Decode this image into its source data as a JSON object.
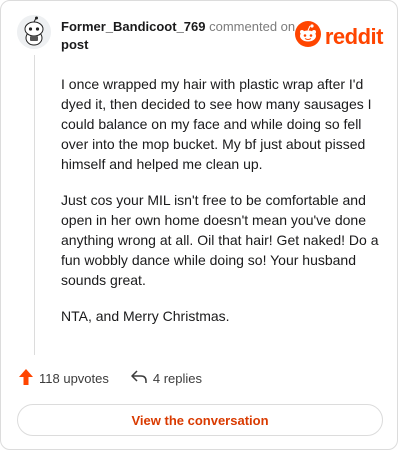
{
  "comment": {
    "username": "Former_Bandicoot_769",
    "action_text": "commented on",
    "post_link": "post",
    "paragraphs": [
      "I once wrapped my hair with plastic wrap after I'd dyed it, then decided to see how many sausages I could balance on my face and while doing so fell over into the mop bucket. My bf just about pissed himself and helped me clean up.",
      "Just cos your MIL isn't free to be comfortable and open in her own home doesn't mean you've done anything wrong at all. Oil that hair! Get naked! Do a fun wobbly dance while doing so! Your husband sounds great.",
      "NTA, and Merry Christmas."
    ]
  },
  "brand": {
    "logo_text": "reddit",
    "accent_color": "#ff4500"
  },
  "stats": {
    "upvotes": "118 upvotes",
    "replies": "4 replies"
  },
  "cta": {
    "label": "View the conversation"
  },
  "icons": {
    "avatar": "snoo-avatar-icon",
    "logo": "reddit-alien-icon",
    "upvote": "upvote-arrow-icon",
    "reply": "reply-arrow-icon"
  }
}
